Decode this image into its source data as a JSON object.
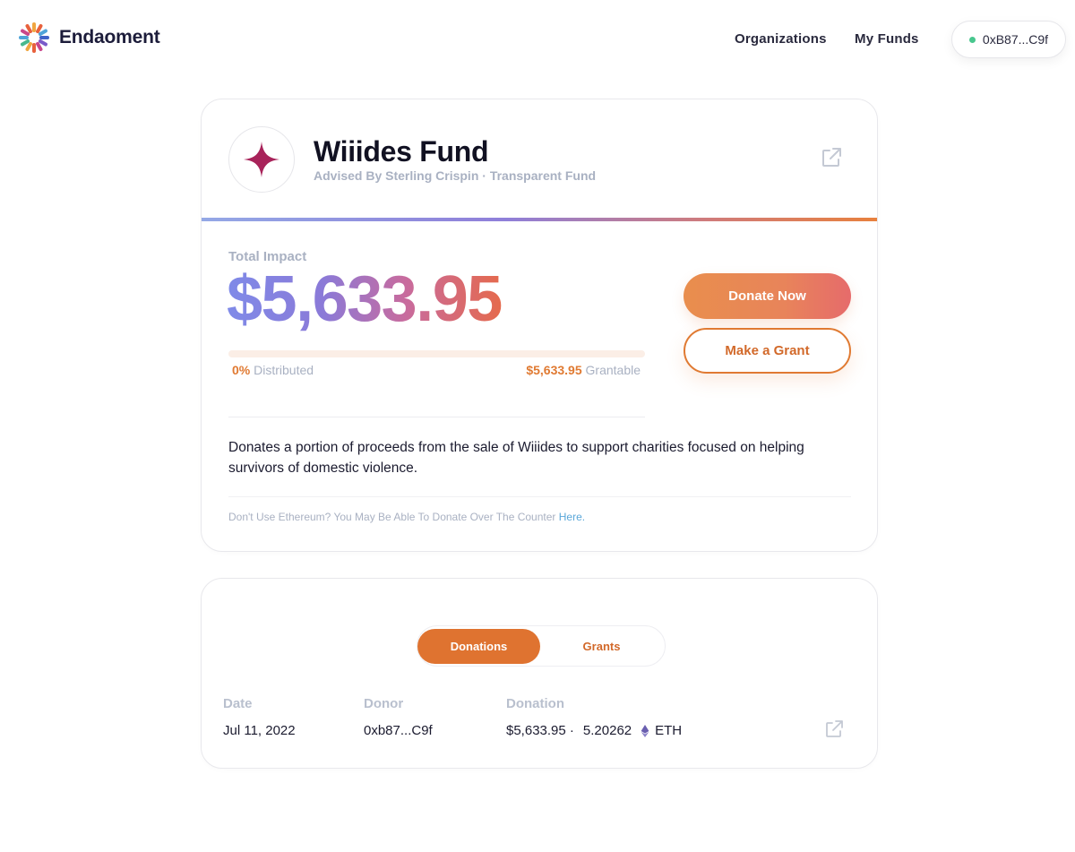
{
  "header": {
    "brand": "Endaoment",
    "nav": [
      {
        "label": "Organizations"
      },
      {
        "label": "My Funds"
      }
    ],
    "wallet": "0xB87...C9f"
  },
  "fund": {
    "title": "Wiiides Fund",
    "subtitle": "Advised By Sterling Crispin · Transparent Fund",
    "impact_label": "Total Impact",
    "impact_value": "$5,633.95",
    "distributed_pct": "0%",
    "distributed_label": "Distributed",
    "grantable_value": "$5,633.95",
    "grantable_label": "Grantable",
    "progress_fraction": 0.0,
    "donate_label": "Donate Now",
    "grant_label": "Make a Grant",
    "description": "Donates a portion of proceeds from the sale of Wiiides to support charities focused on helping survivors of domestic violence.",
    "footnote": "Don't Use Ethereum? You May Be Able To Donate Over The Counter ",
    "footnote_link": "Here."
  },
  "transactions": {
    "tabs": [
      {
        "label": "Donations",
        "active": true
      },
      {
        "label": "Grants",
        "active": false
      }
    ],
    "columns": [
      "Date",
      "Donor",
      "Donation"
    ],
    "rows": [
      {
        "date": "Jul 11, 2022",
        "donor": "0xb87...C9f",
        "usd": "$5,633.95 ·",
        "amount": "5.20262",
        "token": "ETH"
      }
    ]
  },
  "colors": {
    "accent": "#e07a32",
    "muted": "#a9b1c2",
    "wallet_status": "#48c78e"
  }
}
